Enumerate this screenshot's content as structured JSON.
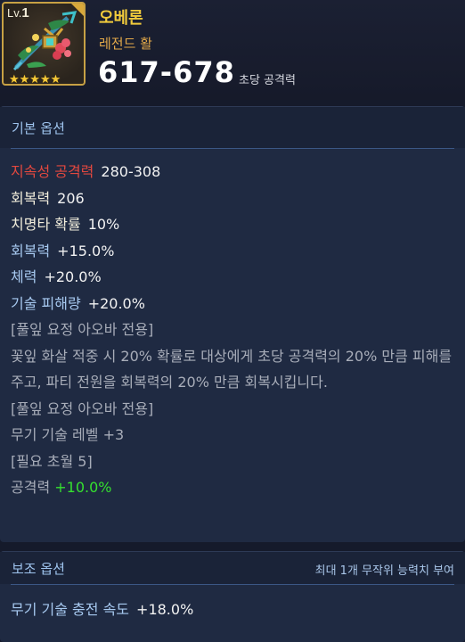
{
  "item": {
    "level_prefix": "Lv.",
    "level": "1",
    "stars": "★★★★★",
    "name": "오베론",
    "grade": "레전드 활",
    "dps_range": "617-678",
    "dps_unit": "초당 공격력",
    "icon": "legendary-bow-icon"
  },
  "basic_options": {
    "title": "기본 옵션",
    "stats": [
      {
        "label": "지속성 공격력",
        "value": "280-308",
        "color": "#e2483f"
      },
      {
        "label": "회복력",
        "value": "206",
        "color": "#f2eedc"
      },
      {
        "label": "치명타 확률",
        "value": "10%",
        "color": "#f2eedc"
      },
      {
        "label": "회복력",
        "value": "+15.0%",
        "color": "#a7c9f0"
      },
      {
        "label": "체력",
        "value": "+20.0%",
        "color": "#a7c9f0"
      },
      {
        "label": "기술 피해량",
        "value": "+20.0%",
        "color": "#a7c9f0"
      }
    ],
    "set_tag_1": "[풀잎 요정 아오바 전용]",
    "description": "꽃잎 화살 적중 시 20% 확률로 대상에게 초당 공격력의 20% 만큼 피해를 주고, 파티 전원을 회복력의 20% 만큼 회복시킵니다.",
    "set_tag_2": "[풀잎 요정 아오바 전용]",
    "skill_level": "무기 기술 레벨 +3",
    "requirement": "[필요 초월 5]",
    "bonus_label": "공격력",
    "bonus_value": "+10.0%"
  },
  "sub_options": {
    "title": "보조 옵션",
    "note": "최대 1개 무작위 능력치 부여",
    "stat_label": "무기 기술 충전 속도",
    "stat_value": "+18.0%"
  },
  "colors": {
    "name": "#f1cb3c",
    "grade": "#e3a94a",
    "bonus": "#35e02f",
    "panel": "#1f2a42"
  }
}
